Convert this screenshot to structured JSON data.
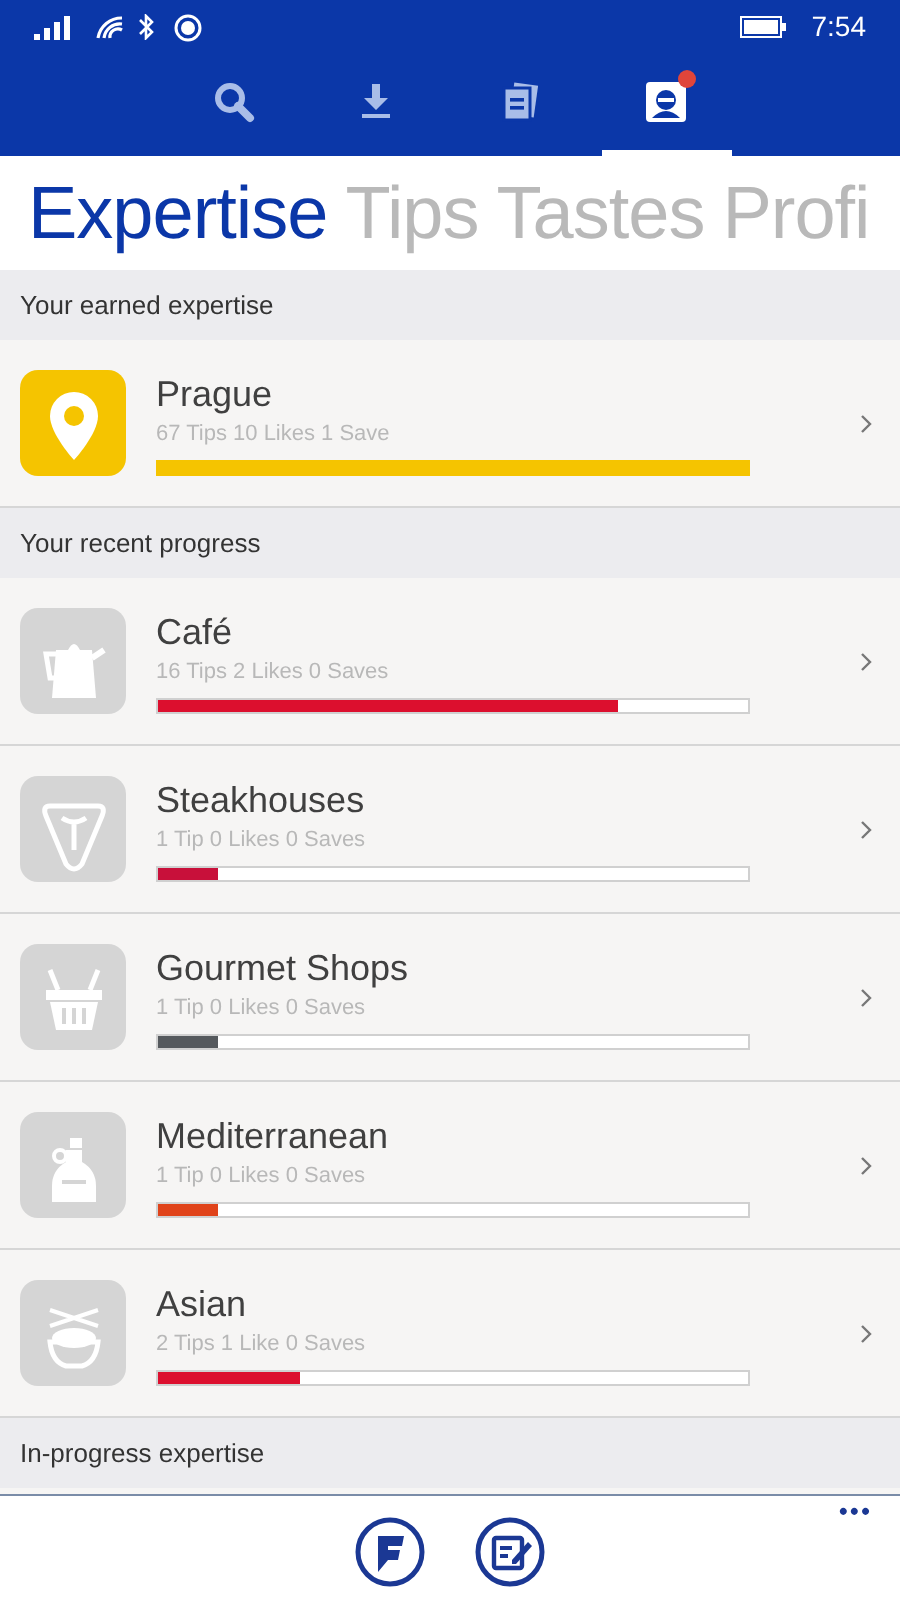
{
  "status_bar": {
    "time": "7:54"
  },
  "nav_tabs": [
    {
      "kind": "search",
      "selected": false,
      "notification": false
    },
    {
      "kind": "download",
      "selected": false,
      "notification": false
    },
    {
      "kind": "documents",
      "selected": false,
      "notification": false
    },
    {
      "kind": "profile",
      "selected": true,
      "notification": true
    }
  ],
  "pivot": [
    {
      "label": "Expertise",
      "selected": true
    },
    {
      "label": "Tips",
      "selected": false
    },
    {
      "label": "Tastes",
      "selected": false
    },
    {
      "label": "Profi",
      "selected": false
    }
  ],
  "sections": [
    {
      "title": "Your earned expertise",
      "items": [
        {
          "kind": "pin",
          "name": "Prague",
          "stats": "67 Tips 10 Likes 1 Save",
          "level": 1.0,
          "color": "#f5c400",
          "earned": true
        }
      ]
    },
    {
      "title": "Your recent progress",
      "items": [
        {
          "kind": "kettle",
          "name": "Café",
          "stats": "16 Tips 2 Likes 0 Saves",
          "level": 0.78,
          "color": "#dc0f2e",
          "earned": false
        },
        {
          "kind": "steak",
          "name": "Steakhouses",
          "stats": "1 Tip 0 Likes 0 Saves",
          "level": 0.1,
          "color": "#c8103a",
          "earned": false
        },
        {
          "kind": "basket",
          "name": "Gourmet Shops",
          "stats": "1 Tip 0 Likes 0 Saves",
          "level": 0.1,
          "color": "#55595d",
          "earned": false
        },
        {
          "kind": "bottle",
          "name": "Mediterranean",
          "stats": "1 Tip 0 Likes 0 Saves",
          "level": 0.1,
          "color": "#e0431a",
          "earned": false
        },
        {
          "kind": "bowl",
          "name": "Asian",
          "stats": "2 Tips 1 Like 0 Saves",
          "level": 0.24,
          "color": "#dc0f2e",
          "earned": false
        }
      ]
    },
    {
      "title": "In-progress expertise"
    }
  ],
  "app_bar": {
    "buttons": [
      {
        "kind": "checkin"
      },
      {
        "kind": "compose"
      }
    ],
    "more": "•••"
  }
}
